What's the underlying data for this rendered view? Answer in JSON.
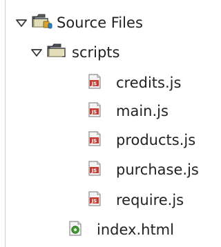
{
  "tree": {
    "root": {
      "label": "Source Files",
      "expanded": true,
      "icon": "source-folder-icon",
      "children": [
        {
          "label": "scripts",
          "expanded": true,
          "icon": "folder-icon",
          "children": [
            {
              "label": "credits.js",
              "icon": "javascript-file-icon"
            },
            {
              "label": "main.js",
              "icon": "javascript-file-icon"
            },
            {
              "label": "products.js",
              "icon": "javascript-file-icon"
            },
            {
              "label": "purchase.js",
              "icon": "javascript-file-icon"
            },
            {
              "label": "require.js",
              "icon": "javascript-file-icon"
            }
          ]
        },
        {
          "label": "index.html",
          "icon": "html-file-icon"
        }
      ]
    }
  },
  "colors": {
    "text": "#222222",
    "toggle": "#333333",
    "rule": "#cfcfcf",
    "folder_dark": "#4a4e52",
    "folder_light": "#f3f0d8",
    "package_gold": "#d7a52a",
    "package_blue": "#2b82c9",
    "js_red": "#c63b31",
    "html_green": "#3f9d2e"
  }
}
